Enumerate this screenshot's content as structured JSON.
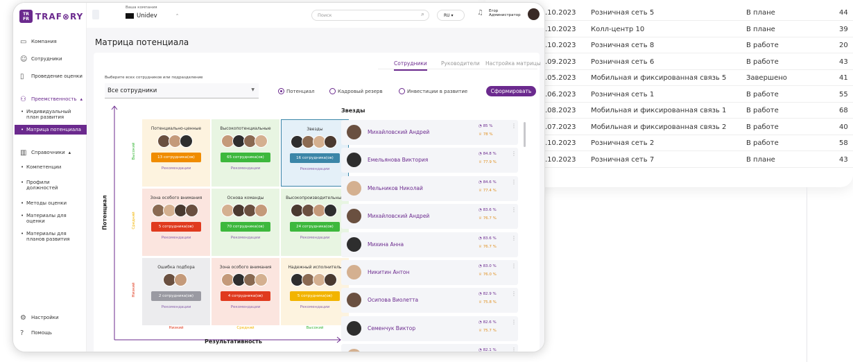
{
  "bg_table": {
    "rows": [
      {
        "date": ".10.2023",
        "name": "Розничная сеть 5",
        "status": "В плане",
        "num": "44"
      },
      {
        "date": ".10.2023",
        "name": "Колл-центр 10",
        "status": "В плане",
        "num": "39"
      },
      {
        "date": ".10.2023",
        "name": "Розничная сеть 8",
        "status": "В работе",
        "num": "20"
      },
      {
        "date": ".09.2023",
        "name": "Розничная сеть 6",
        "status": "В работе",
        "num": "43"
      },
      {
        "date": ".05.2023",
        "name": "Мобильная и фиксированная связь 5",
        "status": "Завершено",
        "num": "41"
      },
      {
        "date": ".06.2023",
        "name": "Розничная сеть 1",
        "status": "В работе",
        "num": "55"
      },
      {
        "date": ".08.2023",
        "name": "Мобильная и фиксированная связь 1",
        "status": "В работе",
        "num": "68"
      },
      {
        "date": ".07.2023",
        "name": "Мобильная и фиксированная связь 2",
        "status": "В работе",
        "num": "40"
      },
      {
        "date": ".10.2023",
        "name": "Розничная сеть 2",
        "status": "В работе",
        "num": "58"
      },
      {
        "date": ".10.2023",
        "name": "Розничная сеть 7",
        "status": "В плане",
        "num": "43"
      }
    ]
  },
  "logo": {
    "box": "TR FR",
    "text": "TRAF⊗RY"
  },
  "sidebar": {
    "company": "Компания",
    "employees": "Сотрудники",
    "assessment": "Проведение оценки",
    "succession": "Преемственность",
    "sub1": [
      "Индивидуальный план развития",
      "Матрица потенциала"
    ],
    "reference": "Справочники",
    "sub2": [
      "Компетенции",
      "Профили должностей",
      "Методы оценки",
      "Материалы для оценки",
      "Материалы для планов развития"
    ],
    "settings": "Настройки",
    "help": "Помощь"
  },
  "topbar": {
    "company_label": "Ваша компания",
    "company": "Unidev",
    "search_placeholder": "Поиск",
    "lang": "RU",
    "user_name": "Егор",
    "user_role": "Администратор"
  },
  "page": {
    "title": "Матрица потенциала",
    "tabs": [
      "Сотрудники",
      "Руководители",
      "Настройка матрицы"
    ],
    "select_label": "Выберите всех сотрудников или подразделение",
    "select_value": "Все сотрудники",
    "radios": [
      "Потенциал",
      "Кадровый резерв",
      "Инвестиции в развитие"
    ],
    "form_button": "Сформировать"
  },
  "matrix": {
    "y_axis": "Потенциал",
    "x_axis": "Результативность",
    "rows": [
      "Высокий",
      "Средний",
      "Низкий"
    ],
    "cols": [
      "Низкий",
      "Средний",
      "Высокий"
    ],
    "rec": "Рекомендации",
    "cells": [
      {
        "title": "Потенциально-ценные",
        "count": "13 сотрудника(ов)"
      },
      {
        "title": "Высокопотенциальные",
        "count": "65 сотрудника(ов)"
      },
      {
        "title": "Звезды",
        "count": "16 сотрудника(ов)"
      },
      {
        "title": "Зона особого внимания",
        "count": "5 сотрудника(ов)"
      },
      {
        "title": "Основа команды",
        "count": "70 сотрудника(ов)"
      },
      {
        "title": "Высокопроизводительные",
        "count": "24 сотрудника(ов)"
      },
      {
        "title": "Ошибка подбора",
        "count": "2 сотрудника(ов)"
      },
      {
        "title": "Зона особого внимания",
        "count": "4 сотрудника(ов)"
      },
      {
        "title": "Надежный исполнитель",
        "count": "5 сотрудника(ов)"
      }
    ],
    "colors": {
      "bg": [
        "#fdf3df",
        "#e8f5e2",
        "#e4f0f8",
        "#fbe5df",
        "#e8f5e2",
        "#e8f5e2",
        "#ececee",
        "#fbe5df",
        "#fdf3df"
      ],
      "btn": [
        "#f08c00",
        "#3db83d",
        "#3b86a8",
        "#e03a1e",
        "#3db83d",
        "#3db83d",
        "#9a9aa2",
        "#e03a1e",
        "#f2b400"
      ]
    }
  },
  "stars": {
    "title": "Звезды",
    "list": [
      {
        "name": "Михайловский Андрей",
        "m1": "85 %",
        "m2": "78 %"
      },
      {
        "name": "Емельянова Виктория",
        "m1": "84.8 %",
        "m2": "77.9 %"
      },
      {
        "name": "Мельников Николай",
        "m1": "84.6 %",
        "m2": "77.4 %"
      },
      {
        "name": "Михайловский Андрей",
        "m1": "83.6 %",
        "m2": "76.7 %"
      },
      {
        "name": "Михина Анна",
        "m1": "83.6 %",
        "m2": "76.7 %"
      },
      {
        "name": "Никитин Антон",
        "m1": "83.0 %",
        "m2": "76.0 %"
      },
      {
        "name": "Осипова Виолетта",
        "m1": "82.9 %",
        "m2": "75.8 %"
      },
      {
        "name": "Семенчук Виктор",
        "m1": "82.6 %",
        "m2": "75.7 %"
      },
      {
        "name": "",
        "m1": "82.1 %",
        "m2": ""
      }
    ]
  }
}
